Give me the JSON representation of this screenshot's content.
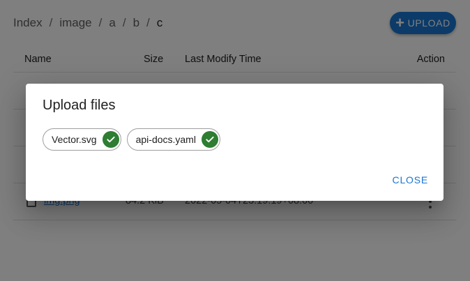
{
  "breadcrumb": {
    "items": [
      "Index",
      "image",
      "a",
      "b",
      "c"
    ],
    "separator": "/"
  },
  "toolbar": {
    "upload_label": "UPLOAD",
    "upload_icon": "plus-icon",
    "accent_color": "#1976d2"
  },
  "table": {
    "headers": {
      "name": "Name",
      "size": "Size",
      "time": "Last Modify Time",
      "action": "Action"
    },
    "rows": [
      {
        "name": "",
        "size": "",
        "time": ""
      },
      {
        "name": "",
        "size": "",
        "time": ""
      },
      {
        "name": "",
        "size": "",
        "time": ""
      },
      {
        "name": "img.png",
        "size": "84.2 KiB",
        "time": "2022-05-04T23:19:19+08:00"
      }
    ]
  },
  "dialog": {
    "title": "Upload files",
    "files": [
      {
        "name": "Vector.svg",
        "status_icon": "check-circle-icon",
        "status_color": "#2e7d32"
      },
      {
        "name": "api-docs.yaml",
        "status_icon": "check-circle-icon",
        "status_color": "#2e7d32"
      }
    ],
    "close_label": "CLOSE"
  }
}
